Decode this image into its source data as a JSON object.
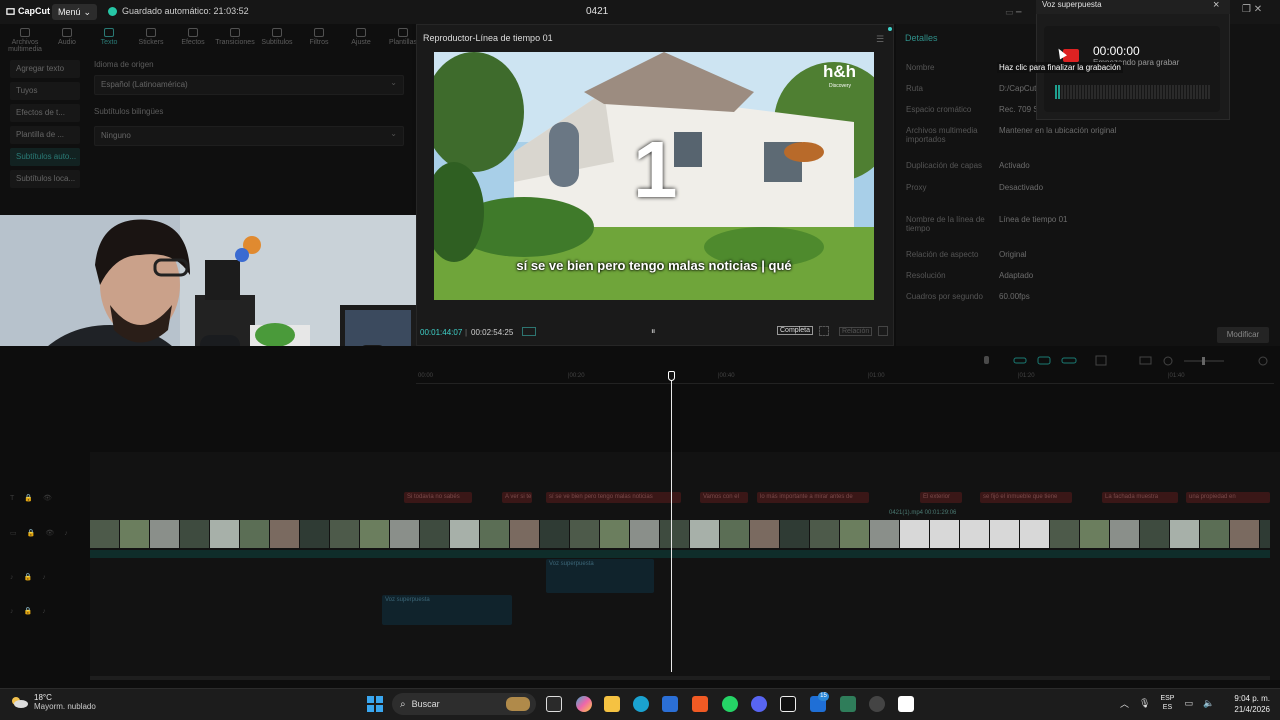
{
  "app": {
    "logo": "CapCut",
    "menu_label": "Menú",
    "autosave": "Guardado automático: 21:03:52",
    "project": "0421"
  },
  "toolbar_tabs": [
    {
      "label": "Archivos multimedia",
      "icon": "media-icon"
    },
    {
      "label": "Audio",
      "icon": "audio-icon"
    },
    {
      "label": "Texto",
      "icon": "text-icon",
      "active": true
    },
    {
      "label": "Stickers",
      "icon": "sticker-icon"
    },
    {
      "label": "Efectos",
      "icon": "effects-icon"
    },
    {
      "label": "Transiciones",
      "icon": "transition-icon"
    },
    {
      "label": "Subtítulos",
      "icon": "captions-icon"
    },
    {
      "label": "Filtros",
      "icon": "filter-icon"
    },
    {
      "label": "Ajuste",
      "icon": "adjust-icon"
    },
    {
      "label": "Plantillas",
      "icon": "template-icon"
    }
  ],
  "left_nav": [
    {
      "label": "Agregar texto"
    },
    {
      "label": "Tuyos"
    },
    {
      "label": "Efectos de t..."
    },
    {
      "label": "Plantilla de ..."
    },
    {
      "label": "Subtítulos auto...",
      "active": true
    },
    {
      "label": "Subtítulos loca..."
    }
  ],
  "captions": {
    "source_lang_label": "Idioma de origen",
    "source_lang_value": "Español (Latinoamérica)",
    "bilingual_label": "Subtítulos bilingües",
    "bilingual_value": "Ninguno"
  },
  "player": {
    "title": "Reproductor-Línea de tiempo 01",
    "watermark": "h&h",
    "watermark_sub": "Discovery",
    "big_number": "1",
    "subtitle": "sí se ve bien pero tengo malas noticias | qué",
    "current_time": "00:01:44:07",
    "total_time": "00:02:54:25",
    "view_label": "Completa",
    "ratio_label": "Relación"
  },
  "details": {
    "title": "Detalles",
    "rows": [
      {
        "label": "Nombre",
        "value": ""
      },
      {
        "label": "Ruta",
        "value": "D:/CapCut"
      },
      {
        "label": "Espacio cromático",
        "value": "Rec. 709 S"
      },
      {
        "label": "Archivos multimedia importados",
        "value": "Mantener en la ubicación original"
      },
      {
        "label": "Duplicación de capas",
        "value": "Activado"
      },
      {
        "label": "Proxy",
        "value": "Desactivado"
      },
      {
        "label": "Nombre de la línea de tiempo",
        "value": "Línea de tiempo 01"
      },
      {
        "label": "Relación de aspecto",
        "value": "Original"
      },
      {
        "label": "Resolución",
        "value": "Adaptado"
      },
      {
        "label": "Cuadros por segundo",
        "value": "60.00fps"
      }
    ],
    "modify_label": "Modificar"
  },
  "voice_over": {
    "title": "Voz superpuesta",
    "time": "00:00:00",
    "hint": "Empezando para grabar",
    "tooltip": "Haz clic para finalizar la grabación"
  },
  "timeline": {
    "ruler_ticks": [
      "00:00",
      "|00:20",
      "|00:40",
      "|01:00",
      "|01:20",
      "|01:40"
    ],
    "text_clips": [
      {
        "label": "Si todavía no sabés"
      },
      {
        "label": "A ver si te cuento"
      },
      {
        "label": "sí se ve bien pero tengo malas noticias"
      },
      {
        "label": "Vamos con el"
      },
      {
        "label": "lo más importante a mirar antes de"
      },
      {
        "label": "El exterior"
      },
      {
        "label": "se fijó el inmueble que tiene"
      },
      {
        "label": "La fachada muestra"
      },
      {
        "label": "una propiedad en"
      }
    ],
    "video_strip_label": "0421(1).mp4  00:01:29:06",
    "vo_clips": [
      {
        "label": "Voz superpuesta"
      },
      {
        "label": "Voz superpuesta"
      }
    ]
  },
  "taskbar": {
    "temperature": "18°C",
    "weather": "Mayorm. nublado",
    "search_placeholder": "Buscar",
    "lang_top": "ESP",
    "lang_bottom": "ES",
    "time": "9:04 p. m.",
    "date": "21/4/2026",
    "badge": "15"
  },
  "colors": {
    "accent": "#3fd0c8",
    "record": "#dd2222",
    "text_clip": "#3a1717"
  }
}
